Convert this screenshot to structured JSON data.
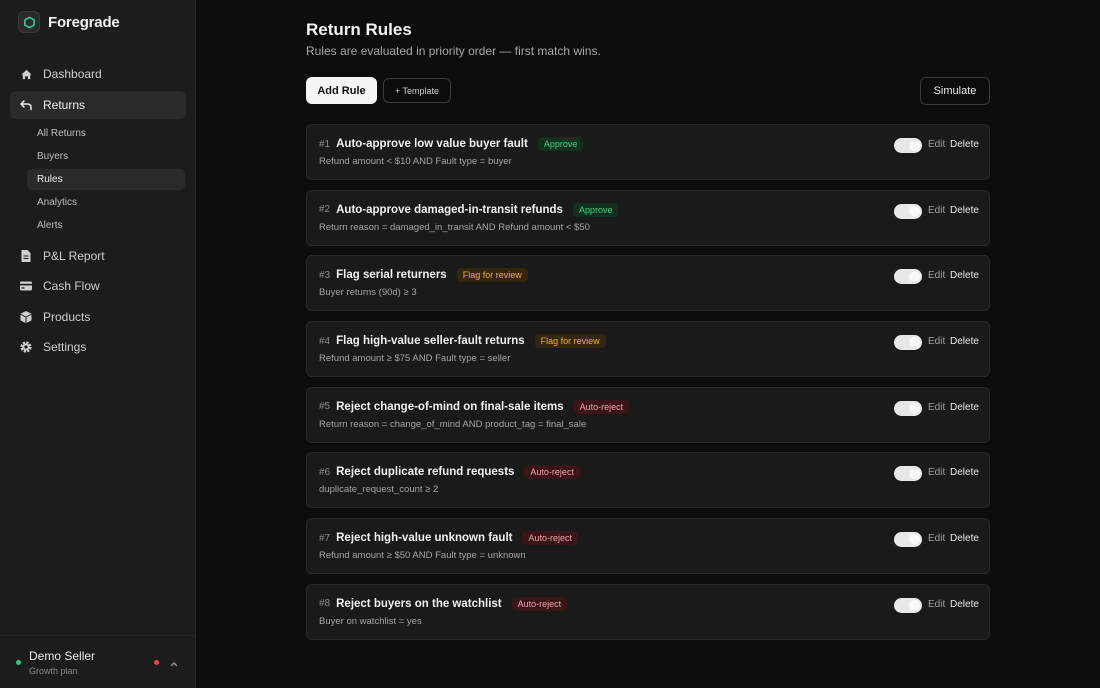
{
  "app": {
    "name": "Foregrade"
  },
  "sidebar": {
    "items": [
      {
        "label": "Dashboard",
        "icon": "home-icon"
      },
      {
        "label": "Returns",
        "icon": "return-arrow-icon",
        "active": true
      },
      {
        "label": "P&L Report",
        "icon": "document-icon"
      },
      {
        "label": "Cash Flow",
        "icon": "credit-card-icon"
      },
      {
        "label": "Products",
        "icon": "box-icon"
      },
      {
        "label": "Settings",
        "icon": "gear-icon"
      }
    ],
    "returns_sub": [
      {
        "label": "All Returns"
      },
      {
        "label": "Buyers"
      },
      {
        "label": "Rules",
        "active": true
      },
      {
        "label": "Analytics"
      },
      {
        "label": "Alerts"
      }
    ]
  },
  "user": {
    "name": "Demo Seller",
    "plan": "Growth plan"
  },
  "page": {
    "title": "Return Rules",
    "subtitle": "Rules are evaluated in priority order — first match wins."
  },
  "toolbar": {
    "add_label": "Add Rule",
    "template_label": "+ Template",
    "simulate_label": "Simulate"
  },
  "row_actions": {
    "edit": "Edit",
    "delete": "Delete"
  },
  "rules": [
    {
      "num": "#1",
      "name": "Auto-approve low value buyer fault",
      "badge": "Approve",
      "badge_type": "approve",
      "condition": "Refund amount < $10 AND Fault type = buyer",
      "enabled": true
    },
    {
      "num": "#2",
      "name": "Auto-approve damaged-in-transit refunds",
      "badge": "Approve",
      "badge_type": "approve",
      "condition": "Return reason = damaged_in_transit AND Refund amount < $50",
      "enabled": true
    },
    {
      "num": "#3",
      "name": "Flag serial returners",
      "badge": "Flag for review",
      "badge_type": "review",
      "condition": "Buyer returns (90d) ≥ 3",
      "enabled": true
    },
    {
      "num": "#4",
      "name": "Flag high-value seller-fault returns",
      "badge": "Flag for review",
      "badge_type": "review",
      "condition": "Refund amount ≥ $75 AND Fault type = seller",
      "enabled": true
    },
    {
      "num": "#5",
      "name": "Reject change-of-mind on final-sale items",
      "badge": "Auto-reject",
      "badge_type": "reject",
      "condition": "Return reason = change_of_mind AND product_tag = final_sale",
      "enabled": true
    },
    {
      "num": "#6",
      "name": "Reject duplicate refund requests",
      "badge": "Auto-reject",
      "badge_type": "reject",
      "condition": "duplicate_request_count ≥ 2",
      "enabled": true
    },
    {
      "num": "#7",
      "name": "Reject high-value unknown fault",
      "badge": "Auto-reject",
      "badge_type": "reject",
      "condition": "Refund amount ≥ $50 AND Fault type = unknown",
      "enabled": true
    },
    {
      "num": "#8",
      "name": "Reject buyers on the watchlist",
      "badge": "Auto-reject",
      "badge_type": "reject",
      "condition": "Buyer on watchlist = yes",
      "enabled": true
    }
  ],
  "colors": {
    "approve": "#3ecf7c",
    "review": "#f2b233",
    "reject": "#f0a0a6",
    "online": "#2ecc71",
    "alert": "#ef4444"
  }
}
